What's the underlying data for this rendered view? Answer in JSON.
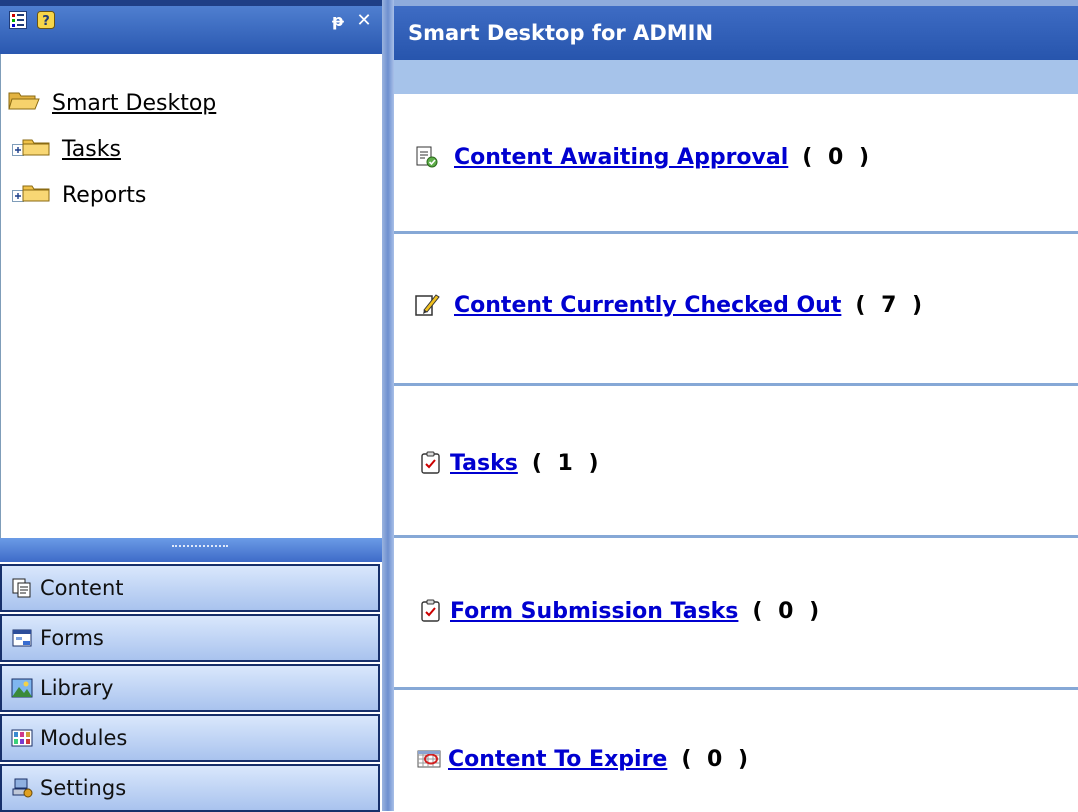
{
  "left_header": {
    "icons": [
      "tree-view-icon",
      "help-icon",
      "pin-icon",
      "close-icon"
    ],
    "pin_glyph": "ᵽ",
    "close_glyph": "✕"
  },
  "tree": {
    "root": {
      "label": "Smart Desktop",
      "icon": "folder-open-icon"
    },
    "children": [
      {
        "label": "Tasks",
        "icon": "folder-icon",
        "expand": "plus-icon"
      },
      {
        "label": "Reports",
        "icon": "folder-icon",
        "expand": "plus-icon"
      }
    ]
  },
  "nav": {
    "items": [
      {
        "label": "Content",
        "icon": "content-icon"
      },
      {
        "label": "Forms",
        "icon": "forms-icon"
      },
      {
        "label": "Library",
        "icon": "library-icon"
      },
      {
        "label": "Modules",
        "icon": "modules-icon"
      },
      {
        "label": "Settings",
        "icon": "settings-icon"
      }
    ]
  },
  "main": {
    "title": "Smart Desktop for ADMIN",
    "items": [
      {
        "label": "Content Awaiting Approval",
        "count": "( 0 )",
        "icon": "approval-icon"
      },
      {
        "label": "Content Currently Checked Out",
        "count": "( 7 )",
        "icon": "checked-out-icon"
      },
      {
        "label": "Tasks",
        "count": "( 1 )",
        "icon": "task-icon"
      },
      {
        "label": "Form Submission Tasks",
        "count": "( 0 )",
        "icon": "task-icon"
      },
      {
        "label": "Content To Expire",
        "count": "( 0 )",
        "icon": "expire-icon"
      }
    ]
  },
  "colors": {
    "header_blue": "#2a58b0",
    "subbar_blue": "#a6c3ea",
    "link_blue": "#0000d0",
    "divider_blue": "#86a8d6"
  }
}
